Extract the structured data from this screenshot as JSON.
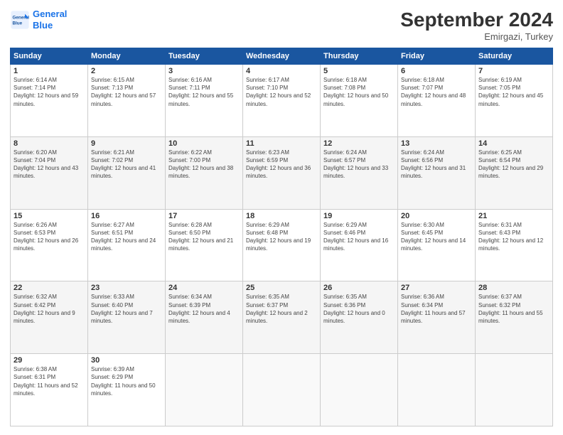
{
  "header": {
    "logo_line1": "General",
    "logo_line2": "Blue",
    "month": "September 2024",
    "location": "Emirgazi, Turkey"
  },
  "weekdays": [
    "Sunday",
    "Monday",
    "Tuesday",
    "Wednesday",
    "Thursday",
    "Friday",
    "Saturday"
  ],
  "weeks": [
    [
      {
        "day": "1",
        "rise": "6:14 AM",
        "set": "7:14 PM",
        "hours": "12 hours and 59 minutes."
      },
      {
        "day": "2",
        "rise": "6:15 AM",
        "set": "7:13 PM",
        "hours": "12 hours and 57 minutes."
      },
      {
        "day": "3",
        "rise": "6:16 AM",
        "set": "7:11 PM",
        "hours": "12 hours and 55 minutes."
      },
      {
        "day": "4",
        "rise": "6:17 AM",
        "set": "7:10 PM",
        "hours": "12 hours and 52 minutes."
      },
      {
        "day": "5",
        "rise": "6:18 AM",
        "set": "7:08 PM",
        "hours": "12 hours and 50 minutes."
      },
      {
        "day": "6",
        "rise": "6:18 AM",
        "set": "7:07 PM",
        "hours": "12 hours and 48 minutes."
      },
      {
        "day": "7",
        "rise": "6:19 AM",
        "set": "7:05 PM",
        "hours": "12 hours and 45 minutes."
      }
    ],
    [
      {
        "day": "8",
        "rise": "6:20 AM",
        "set": "7:04 PM",
        "hours": "12 hours and 43 minutes."
      },
      {
        "day": "9",
        "rise": "6:21 AM",
        "set": "7:02 PM",
        "hours": "12 hours and 41 minutes."
      },
      {
        "day": "10",
        "rise": "6:22 AM",
        "set": "7:00 PM",
        "hours": "12 hours and 38 minutes."
      },
      {
        "day": "11",
        "rise": "6:23 AM",
        "set": "6:59 PM",
        "hours": "12 hours and 36 minutes."
      },
      {
        "day": "12",
        "rise": "6:24 AM",
        "set": "6:57 PM",
        "hours": "12 hours and 33 minutes."
      },
      {
        "day": "13",
        "rise": "6:24 AM",
        "set": "6:56 PM",
        "hours": "12 hours and 31 minutes."
      },
      {
        "day": "14",
        "rise": "6:25 AM",
        "set": "6:54 PM",
        "hours": "12 hours and 29 minutes."
      }
    ],
    [
      {
        "day": "15",
        "rise": "6:26 AM",
        "set": "6:53 PM",
        "hours": "12 hours and 26 minutes."
      },
      {
        "day": "16",
        "rise": "6:27 AM",
        "set": "6:51 PM",
        "hours": "12 hours and 24 minutes."
      },
      {
        "day": "17",
        "rise": "6:28 AM",
        "set": "6:50 PM",
        "hours": "12 hours and 21 minutes."
      },
      {
        "day": "18",
        "rise": "6:29 AM",
        "set": "6:48 PM",
        "hours": "12 hours and 19 minutes."
      },
      {
        "day": "19",
        "rise": "6:29 AM",
        "set": "6:46 PM",
        "hours": "12 hours and 16 minutes."
      },
      {
        "day": "20",
        "rise": "6:30 AM",
        "set": "6:45 PM",
        "hours": "12 hours and 14 minutes."
      },
      {
        "day": "21",
        "rise": "6:31 AM",
        "set": "6:43 PM",
        "hours": "12 hours and 12 minutes."
      }
    ],
    [
      {
        "day": "22",
        "rise": "6:32 AM",
        "set": "6:42 PM",
        "hours": "12 hours and 9 minutes."
      },
      {
        "day": "23",
        "rise": "6:33 AM",
        "set": "6:40 PM",
        "hours": "12 hours and 7 minutes."
      },
      {
        "day": "24",
        "rise": "6:34 AM",
        "set": "6:39 PM",
        "hours": "12 hours and 4 minutes."
      },
      {
        "day": "25",
        "rise": "6:35 AM",
        "set": "6:37 PM",
        "hours": "12 hours and 2 minutes."
      },
      {
        "day": "26",
        "rise": "6:35 AM",
        "set": "6:36 PM",
        "hours": "12 hours and 0 minutes."
      },
      {
        "day": "27",
        "rise": "6:36 AM",
        "set": "6:34 PM",
        "hours": "11 hours and 57 minutes."
      },
      {
        "day": "28",
        "rise": "6:37 AM",
        "set": "6:32 PM",
        "hours": "11 hours and 55 minutes."
      }
    ],
    [
      {
        "day": "29",
        "rise": "6:38 AM",
        "set": "6:31 PM",
        "hours": "11 hours and 52 minutes."
      },
      {
        "day": "30",
        "rise": "6:39 AM",
        "set": "6:29 PM",
        "hours": "11 hours and 50 minutes."
      },
      null,
      null,
      null,
      null,
      null
    ]
  ]
}
